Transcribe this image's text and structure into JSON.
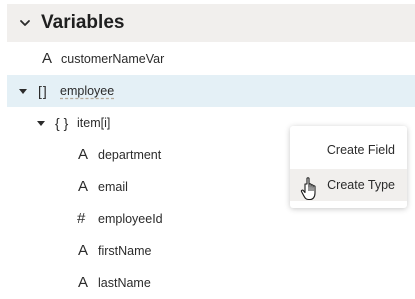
{
  "header": {
    "title": "Variables",
    "collapse_icon": "chevron-down-icon"
  },
  "tree": {
    "customer_name_var": {
      "icon": "A",
      "label": "customerNameVar"
    },
    "employee": {
      "icon": "[]",
      "label": "employee",
      "expanded": true,
      "selected": true
    },
    "item": {
      "icon": "{ }",
      "label": "item[i]",
      "expanded": true
    },
    "department": {
      "icon": "A",
      "label": "department"
    },
    "email": {
      "icon": "A",
      "label": "email"
    },
    "employee_id": {
      "icon": "#",
      "label": "employeeId"
    },
    "first_name": {
      "icon": "A",
      "label": "firstName"
    },
    "last_name": {
      "icon": "A",
      "label": "lastName"
    }
  },
  "context_menu": {
    "create_field": "Create Field",
    "create_type": "Create Type",
    "hovered_item": "Create Type"
  },
  "colors": {
    "header_bg": "#f1efed",
    "selected_row_bg": "#e4f0f6",
    "menu_hover_bg": "#f1efed"
  }
}
